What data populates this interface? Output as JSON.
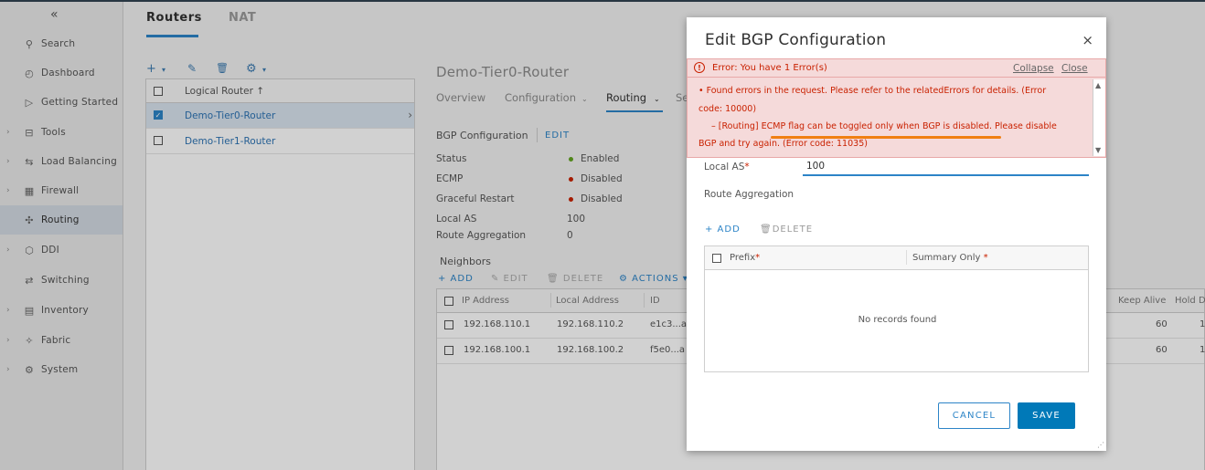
{
  "sidebar": {
    "collapse_glyph": "«",
    "items": [
      {
        "label": "Search",
        "icon": "search-icon",
        "glyph": "⚲",
        "caret": ""
      },
      {
        "label": "Dashboard",
        "icon": "dashboard-icon",
        "glyph": "◴",
        "caret": ""
      },
      {
        "label": "Getting Started",
        "icon": "play-icon",
        "glyph": "▷",
        "caret": ""
      },
      {
        "label": "Tools",
        "icon": "toolbox-icon",
        "glyph": "⊟",
        "caret": "›"
      },
      {
        "label": "Load Balancing",
        "icon": "load-balancer-icon",
        "glyph": "⇆",
        "caret": "›"
      },
      {
        "label": "Firewall",
        "icon": "firewall-icon",
        "glyph": "▦",
        "caret": "›"
      },
      {
        "label": "Routing",
        "icon": "routing-icon",
        "glyph": "✣",
        "caret": "",
        "active": true
      },
      {
        "label": "DDI",
        "icon": "ddi-icon",
        "glyph": "⬡",
        "caret": "›"
      },
      {
        "label": "Switching",
        "icon": "switching-icon",
        "glyph": "⇄",
        "caret": ""
      },
      {
        "label": "Inventory",
        "icon": "inventory-icon",
        "glyph": "▤",
        "caret": "›"
      },
      {
        "label": "Fabric",
        "icon": "fabric-icon",
        "glyph": "✧",
        "caret": "›"
      },
      {
        "label": "System",
        "icon": "gear-icon",
        "glyph": "⚙",
        "caret": "›"
      }
    ]
  },
  "tabs": {
    "routers": "Routers",
    "nat": "NAT"
  },
  "toolbar": {
    "add": "+",
    "add_caret": "▾",
    "edit": "✎",
    "delete": "🗑",
    "settings": "⚙",
    "settings_caret": "▾"
  },
  "router_list": {
    "header": "Logical Router ↑",
    "rows": [
      {
        "name": "Demo-Tier0-Router",
        "selected": true
      },
      {
        "name": "Demo-Tier1-Router",
        "selected": false
      }
    ]
  },
  "detail": {
    "title": "Demo-Tier0-Router",
    "subtabs": {
      "overview": "Overview",
      "configuration": "Configuration",
      "routing": "Routing",
      "services": "Se"
    },
    "bgp_title": "BGP Configuration",
    "bgp_edit": "EDIT",
    "fields": [
      {
        "key": "Status",
        "value": "Enabled",
        "color": "#62a420"
      },
      {
        "key": "ECMP",
        "value": "Disabled",
        "color": "#c92100"
      },
      {
        "key": "Graceful Restart",
        "value": "Disabled",
        "color": "#c92100"
      },
      {
        "key": "Local AS",
        "value": "100"
      },
      {
        "key": "Route Aggregation",
        "value": "0"
      }
    ],
    "neighbors_title": "Neighbors",
    "neighbors_actions": {
      "add": "+ ADD",
      "edit": "✎ EDIT",
      "delete": "🗑 DELETE",
      "actions": "⚙ ACTIONS ▾"
    },
    "neighbors_table": {
      "columns": [
        "IP Address",
        "Local Address",
        "ID",
        "Keep Alive",
        "Hold D"
      ],
      "rows": [
        {
          "ip": "192.168.110.1",
          "local": "192.168.110.2",
          "id": "e1c3...a",
          "keepalive": "60",
          "hold": "1"
        },
        {
          "ip": "192.168.100.1",
          "local": "192.168.100.2",
          "id": "f5e0...a",
          "keepalive": "60",
          "hold": "1"
        }
      ]
    }
  },
  "modal": {
    "title": "Edit BGP Configuration",
    "close": "×",
    "error_bar": {
      "text": "Error: You have 1 Error(s)",
      "collapse": "Collapse",
      "close": "Close"
    },
    "error_lines": [
      "•   Found errors in the request. Please refer to the relatedErrors for details. (Error",
      "code: 10000)",
      "–   [Routing] ECMP flag can be toggled only when BGP is disabled. Please disable",
      "BGP and try again. (Error code: 11035)"
    ],
    "local_as_label": "Local AS",
    "local_as_value": "100",
    "route_agg_label": "Route Aggregation",
    "agg_add": "+ ADD",
    "agg_delete": "DELETE",
    "agg_columns": {
      "prefix": "Prefix",
      "summary": "Summary Only"
    },
    "agg_empty": "No records found",
    "cancel": "CANCEL",
    "save": "SAVE",
    "colors": {
      "primary": "#0079b8",
      "error": "#c92100",
      "error_bg": "#f5dada",
      "highlight": "#f07f12"
    }
  }
}
